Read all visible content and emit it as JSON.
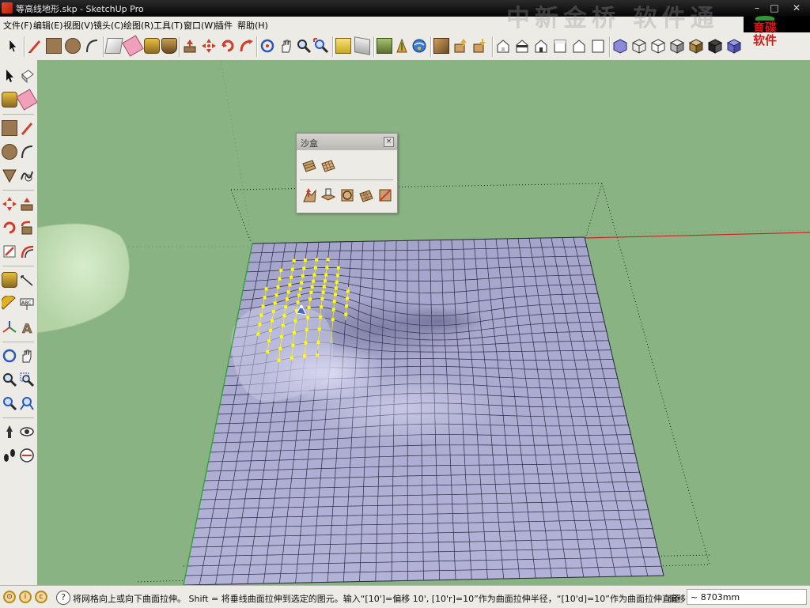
{
  "window": {
    "title": "等高线地形.skp - SketchUp Pro"
  },
  "watermark": "中新金桥 软件通",
  "brand": {
    "line1": "育碟",
    "line2": "软件"
  },
  "menu": [
    "文件(F)",
    "编辑(E)",
    "视图(V)",
    "镜头(C)",
    "绘图(R)",
    "工具(T)",
    "窗口(W)",
    "插件",
    "帮助(H)"
  ],
  "sandbox": {
    "title": "沙盒"
  },
  "status": {
    "hint": "将网格向上或向下曲面拉伸。 Shift = 将垂线曲面拉伸到选定的图元。输入“[10']=偏移 10', [10'r]=10”作为曲面拉伸半径，“[10'd]=10”作为曲面拉伸直径",
    "measure_label": "偏移",
    "measure_value": "~ 8703mm"
  },
  "colors": {
    "viewport_bg": "#8ab384",
    "terrain_face": "#aeaed3",
    "selection": "#ffff00",
    "axis_red": "#cc2222"
  }
}
